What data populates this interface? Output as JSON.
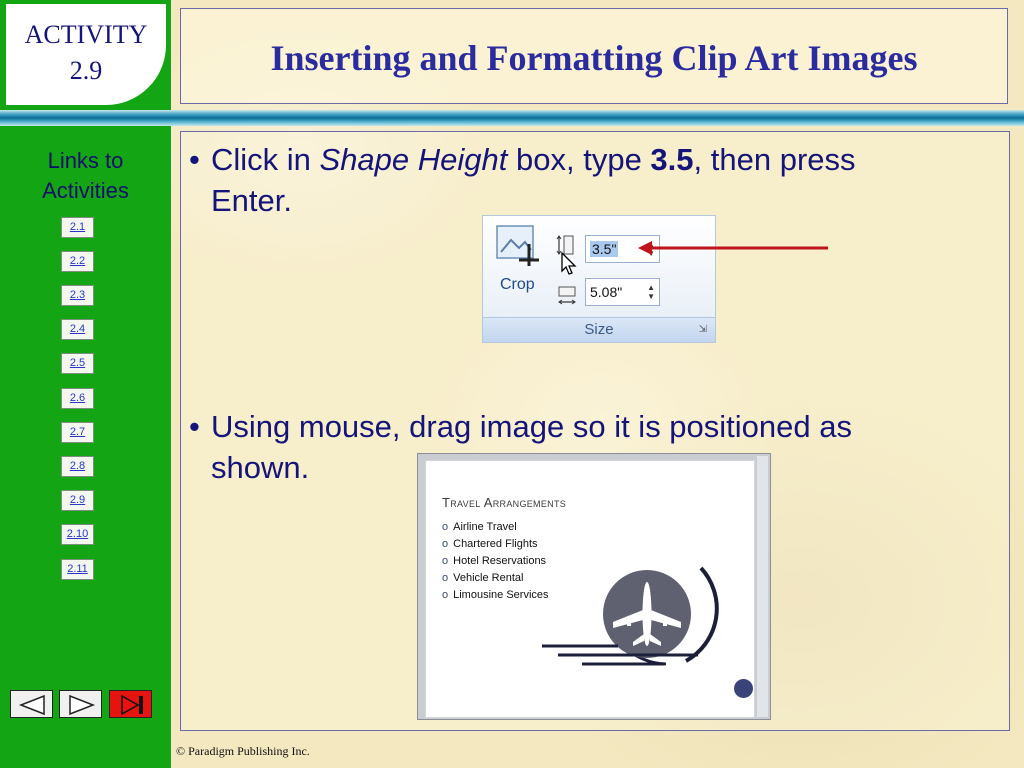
{
  "activity": {
    "label": "ACTIVITY",
    "number": "2.9"
  },
  "title": "Inserting and Formatting Clip Art Images",
  "sidebar": {
    "heading_line1": "Links to",
    "heading_line2": "Activities",
    "links": [
      "2.1",
      "2.2",
      "2.3",
      "2.4",
      "2.5",
      "2.6",
      "2.7",
      "2.8",
      "2.9",
      "2.10",
      "2.11"
    ]
  },
  "nav": {
    "icons": [
      "previous-arrow-icon",
      "next-arrow-icon",
      "end-icon"
    ]
  },
  "bullets": [
    {
      "dot": "•",
      "pre": "Click in ",
      "italic": "Shape Height",
      "mid": " box, type ",
      "bold": "3.5",
      "post": ", then press",
      "line2": "Enter."
    },
    {
      "dot": "•",
      "line1": "Using mouse, drag image so it is positioned as",
      "line2": "shown."
    }
  ],
  "ribbon": {
    "crop_label": "Crop",
    "height_value": "3.5\"",
    "width_value": "5.08\"",
    "group_label": "Size",
    "arrow_color": "#c0141c"
  },
  "slide": {
    "title": "Travel Arrangements",
    "items": [
      "Airline Travel",
      "Chartered Flights",
      "Hotel Reservations",
      "Vehicle Rental",
      "Limousine Services"
    ],
    "item_marker": "o",
    "icon": "airplane-icon",
    "icon_color": "#5f6070"
  },
  "footer": "© Paradigm Publishing Inc.",
  "colors": {
    "sidebar_green": "#14a514",
    "title_blue": "#2b2ba0",
    "text_navy": "#14147a",
    "band_blue": "#0a6e9a",
    "end_button_red": "#e5140f"
  }
}
